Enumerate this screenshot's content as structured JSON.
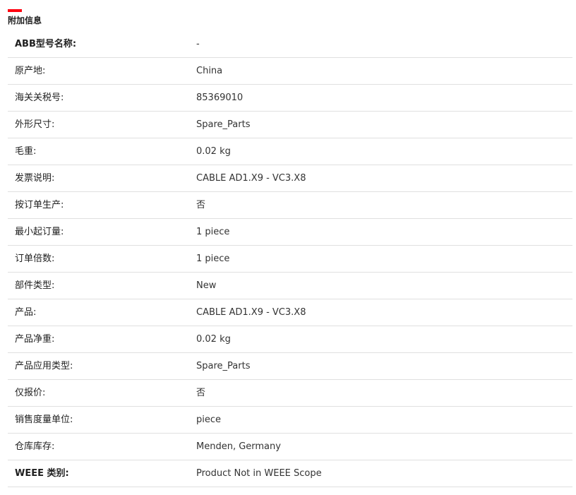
{
  "section": {
    "accent_color": "#ff000f",
    "title": "附加信息"
  },
  "rows": [
    {
      "label": "ABB型号名称:",
      "value": "-",
      "label_bold": true
    },
    {
      "label": "原产地:",
      "value": "China",
      "label_bold": false
    },
    {
      "label": "海关关税号:",
      "value": "85369010",
      "label_bold": false
    },
    {
      "label": "外形尺寸:",
      "value": "Spare_Parts",
      "label_bold": false
    },
    {
      "label": "毛重:",
      "value": "0.02 kg",
      "label_bold": false
    },
    {
      "label": "发票说明:",
      "value": "CABLE AD1.X9 - VC3.X8",
      "label_bold": false
    },
    {
      "label": "按订单生产:",
      "value": "否",
      "label_bold": false
    },
    {
      "label": "最小起订量:",
      "value": "1 piece",
      "label_bold": false
    },
    {
      "label": "订单倍数:",
      "value": "1 piece",
      "label_bold": false
    },
    {
      "label": "部件类型:",
      "value": "New",
      "label_bold": false
    },
    {
      "label": "产品:",
      "value": "CABLE AD1.X9 - VC3.X8",
      "label_bold": false
    },
    {
      "label": "产品净重:",
      "value": "0.02 kg",
      "label_bold": false
    },
    {
      "label": "产品应用类型:",
      "value": "Spare_Parts",
      "label_bold": false
    },
    {
      "label": "仅报价:",
      "value": "否",
      "label_bold": false
    },
    {
      "label": "销售度量单位:",
      "value": "piece",
      "label_bold": false
    },
    {
      "label": "仓库库存:",
      "value": "Menden, Germany",
      "label_bold": false
    },
    {
      "label": "WEEE 类别:",
      "value": "Product Not in WEEE Scope",
      "label_bold": true
    }
  ]
}
